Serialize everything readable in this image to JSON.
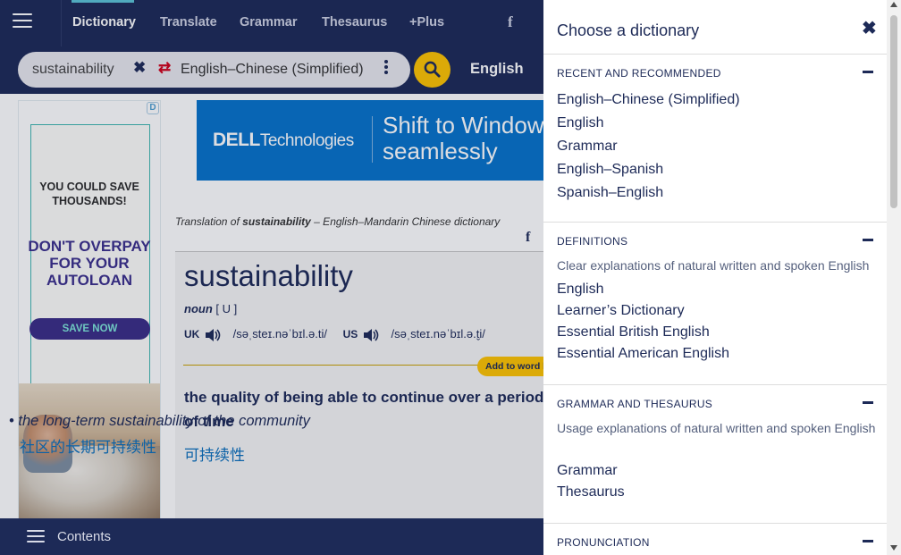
{
  "nav": {
    "items": [
      "Dictionary",
      "Translate",
      "Grammar",
      "Thesaurus",
      "+Plus"
    ],
    "facebook_glyph": "f"
  },
  "search": {
    "value": "sustainability",
    "dictionary": "English–Chinese (Simplified)",
    "language": "English"
  },
  "ads": {
    "left_badge": "D",
    "left_save": "YOU COULD SAVE THOUSANDS!",
    "left_headline": "DON'T OVERPAY FOR YOUR AUTOLOAN",
    "left_cta": "SAVE NOW",
    "banner_brand": "DELL",
    "banner_brand_sub": "Technologies",
    "banner_line1": "Shift to Windows",
    "banner_line2": "seamlessly"
  },
  "entry": {
    "breadcrumb_prefix": "Translation of ",
    "breadcrumb_word": "sustainability",
    "breadcrumb_suffix": " – English–Mandarin Chinese dictionary",
    "share_glyph": "f",
    "headword": "sustainability",
    "pos": "noun",
    "grammar_code": "[ U ]",
    "uk_label": "UK",
    "uk_ipa": "/səˌsteɪ.nəˈbɪl.ə.ti/",
    "us_label": "US",
    "us_ipa": "/səˌsteɪ.nəˈbɪl.ə.t̬i/",
    "wordlist_button": "Add to word list",
    "definition": "the quality of being able to continue over a period of time",
    "translation": "可持续性",
    "example": "the long-term sustainability of the community",
    "example_translation": "社区的长期可持续性"
  },
  "bottom": {
    "contents_label": "Contents"
  },
  "panel": {
    "title": "Choose a dictionary",
    "close_glyph": "✖",
    "sections": [
      {
        "heading": "RECENT AND RECOMMENDED",
        "items": [
          "English–Chinese (Simplified)",
          "English",
          "Grammar",
          "English–Spanish",
          "Spanish–English"
        ]
      },
      {
        "heading": "DEFINITIONS",
        "description": "Clear explanations of natural written and spoken English",
        "items": [
          "English",
          "Learner’s Dictionary",
          "Essential British English",
          "Essential American English"
        ]
      },
      {
        "heading": "GRAMMAR AND THESAURUS",
        "description": "Usage explanations of natural written and spoken English",
        "items": [
          "Grammar",
          "Thesaurus"
        ]
      },
      {
        "heading": "PRONUNCIATION"
      }
    ]
  },
  "colors": {
    "navy": "#1d2a57",
    "accent_yellow": "#fec400",
    "link_blue": "#0b6fbb",
    "nav_active_underline": "#5bc3d6"
  }
}
